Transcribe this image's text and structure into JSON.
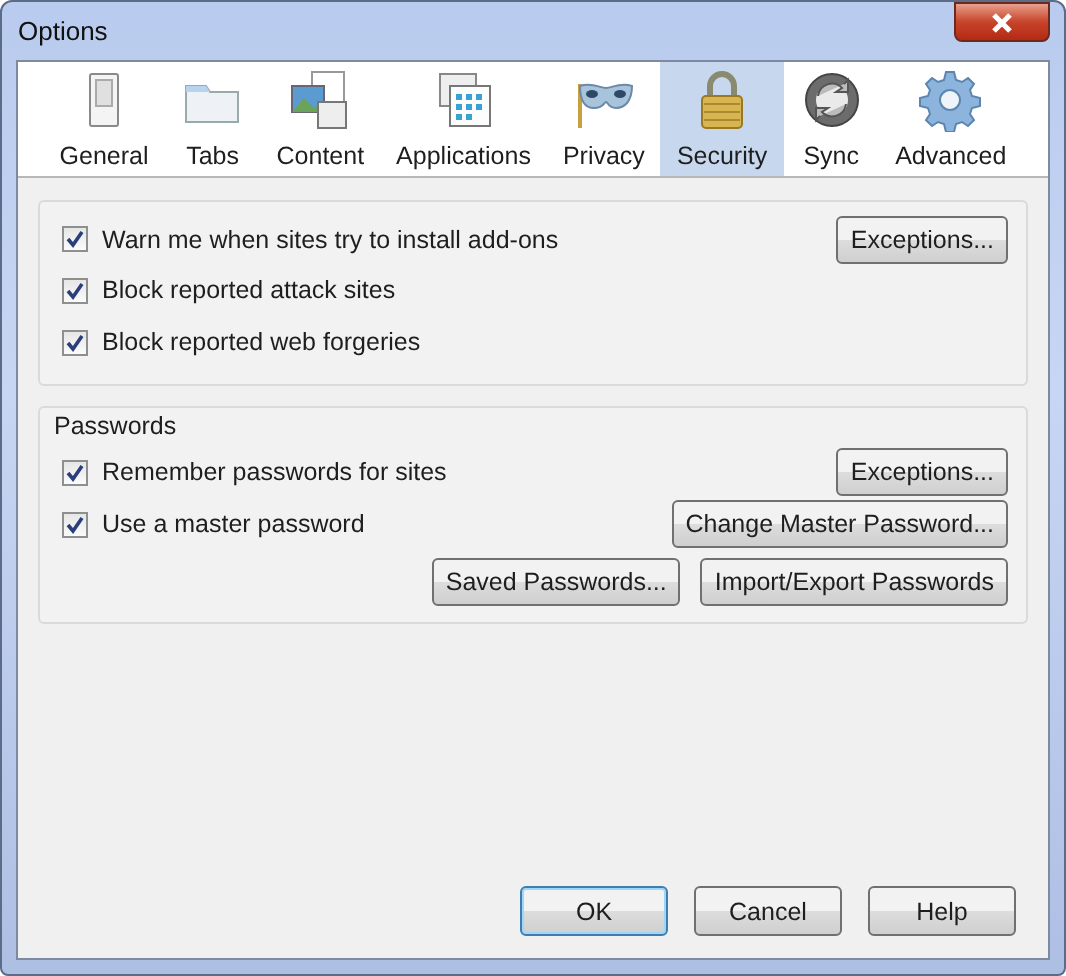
{
  "window": {
    "title": "Options"
  },
  "tabs": [
    {
      "label": "General",
      "selected": false
    },
    {
      "label": "Tabs",
      "selected": false
    },
    {
      "label": "Content",
      "selected": false
    },
    {
      "label": "Applications",
      "selected": false
    },
    {
      "label": "Privacy",
      "selected": false
    },
    {
      "label": "Security",
      "selected": true
    },
    {
      "label": "Sync",
      "selected": false
    },
    {
      "label": "Advanced",
      "selected": false
    }
  ],
  "general_group": {
    "options": [
      {
        "label": "Warn me when sites try to install add-ons",
        "checked": true,
        "button": "Exceptions..."
      },
      {
        "label": "Block reported attack sites",
        "checked": true
      },
      {
        "label": "Block reported web forgeries",
        "checked": true
      }
    ]
  },
  "passwords_group": {
    "title": "Passwords",
    "options": [
      {
        "label": "Remember passwords for sites",
        "checked": true,
        "button": "Exceptions..."
      },
      {
        "label": "Use a master password",
        "checked": true,
        "button": "Change Master Password..."
      }
    ],
    "buttons": [
      "Saved Passwords...",
      "Import/Export Passwords"
    ]
  },
  "dialog_buttons": [
    {
      "label": "OK",
      "focused": true
    },
    {
      "label": "Cancel",
      "focused": false
    },
    {
      "label": "Help",
      "focused": false
    }
  ]
}
